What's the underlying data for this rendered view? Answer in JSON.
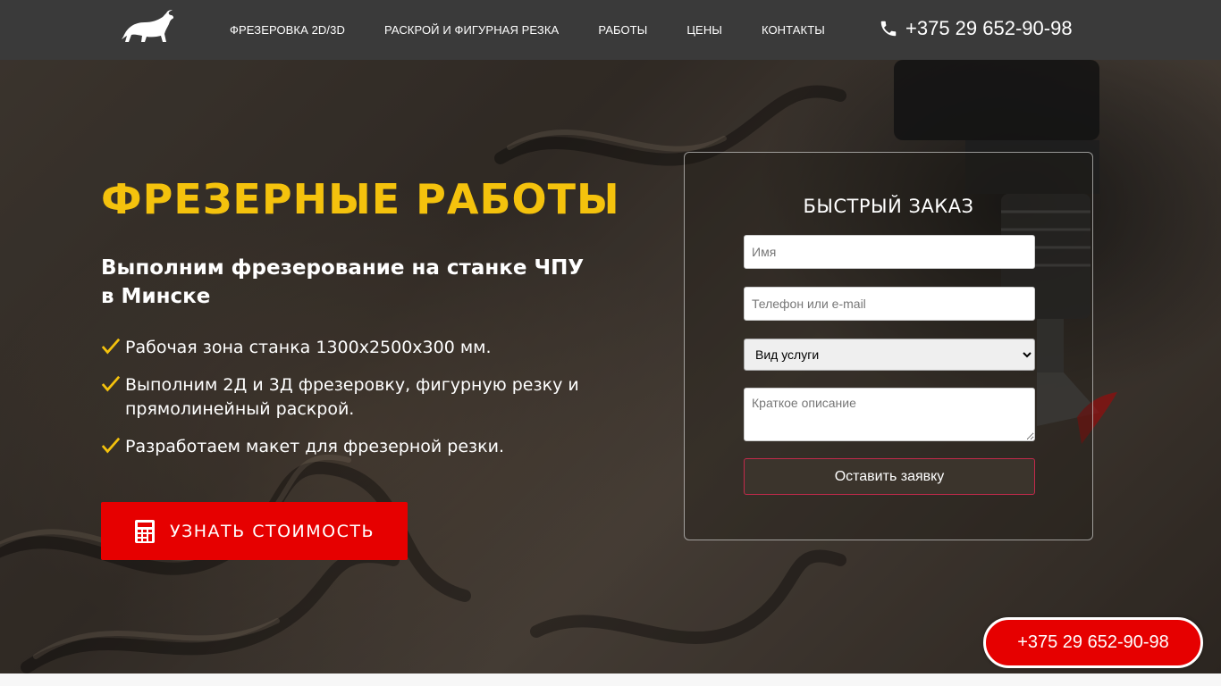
{
  "header": {
    "logo_icon": "bull-logo-icon",
    "nav": [
      {
        "label": "ФРЕЗЕРОВКА 2D/3D"
      },
      {
        "label": "РАСКРОЙ И ФИГУРНАЯ РЕЗКА"
      },
      {
        "label": "РАБОТЫ"
      },
      {
        "label": "ЦЕНЫ"
      },
      {
        "label": "КОНТАКТЫ"
      }
    ],
    "phone_icon": "phone-icon",
    "phone": "+375 29 652-90-98"
  },
  "hero": {
    "title": "ФРЕЗЕРНЫЕ РАБОТЫ",
    "subtitle": "Выполним фрезерование на станке ЧПУ в Минске",
    "features": [
      {
        "text": "Рабочая зона станка 1300х2500х300 мм."
      },
      {
        "text": "Выполним 2Д и 3Д фрезеровку, фигурную резку и прямолинейный раскрой."
      },
      {
        "text": "Разработаем макет для фрезерной резки."
      }
    ],
    "check_icon": "checkmark-icon",
    "cta_icon": "calculator-icon",
    "cta_label": "УЗНАТЬ СТОИМОСТЬ"
  },
  "form": {
    "title": "БЫСТРЫЙ ЗАКАЗ",
    "name_placeholder": "Имя",
    "contact_placeholder": "Телефон или e-mail",
    "service_selected": "Вид услуги",
    "description_placeholder": "Краткое описание",
    "submit_label": "Оставить заявку"
  },
  "floating_phone": "+375 29 652-90-98",
  "colors": {
    "accent_yellow": "#f4c20d",
    "accent_red": "#e60000",
    "header_bg": "#3a3a3a"
  }
}
